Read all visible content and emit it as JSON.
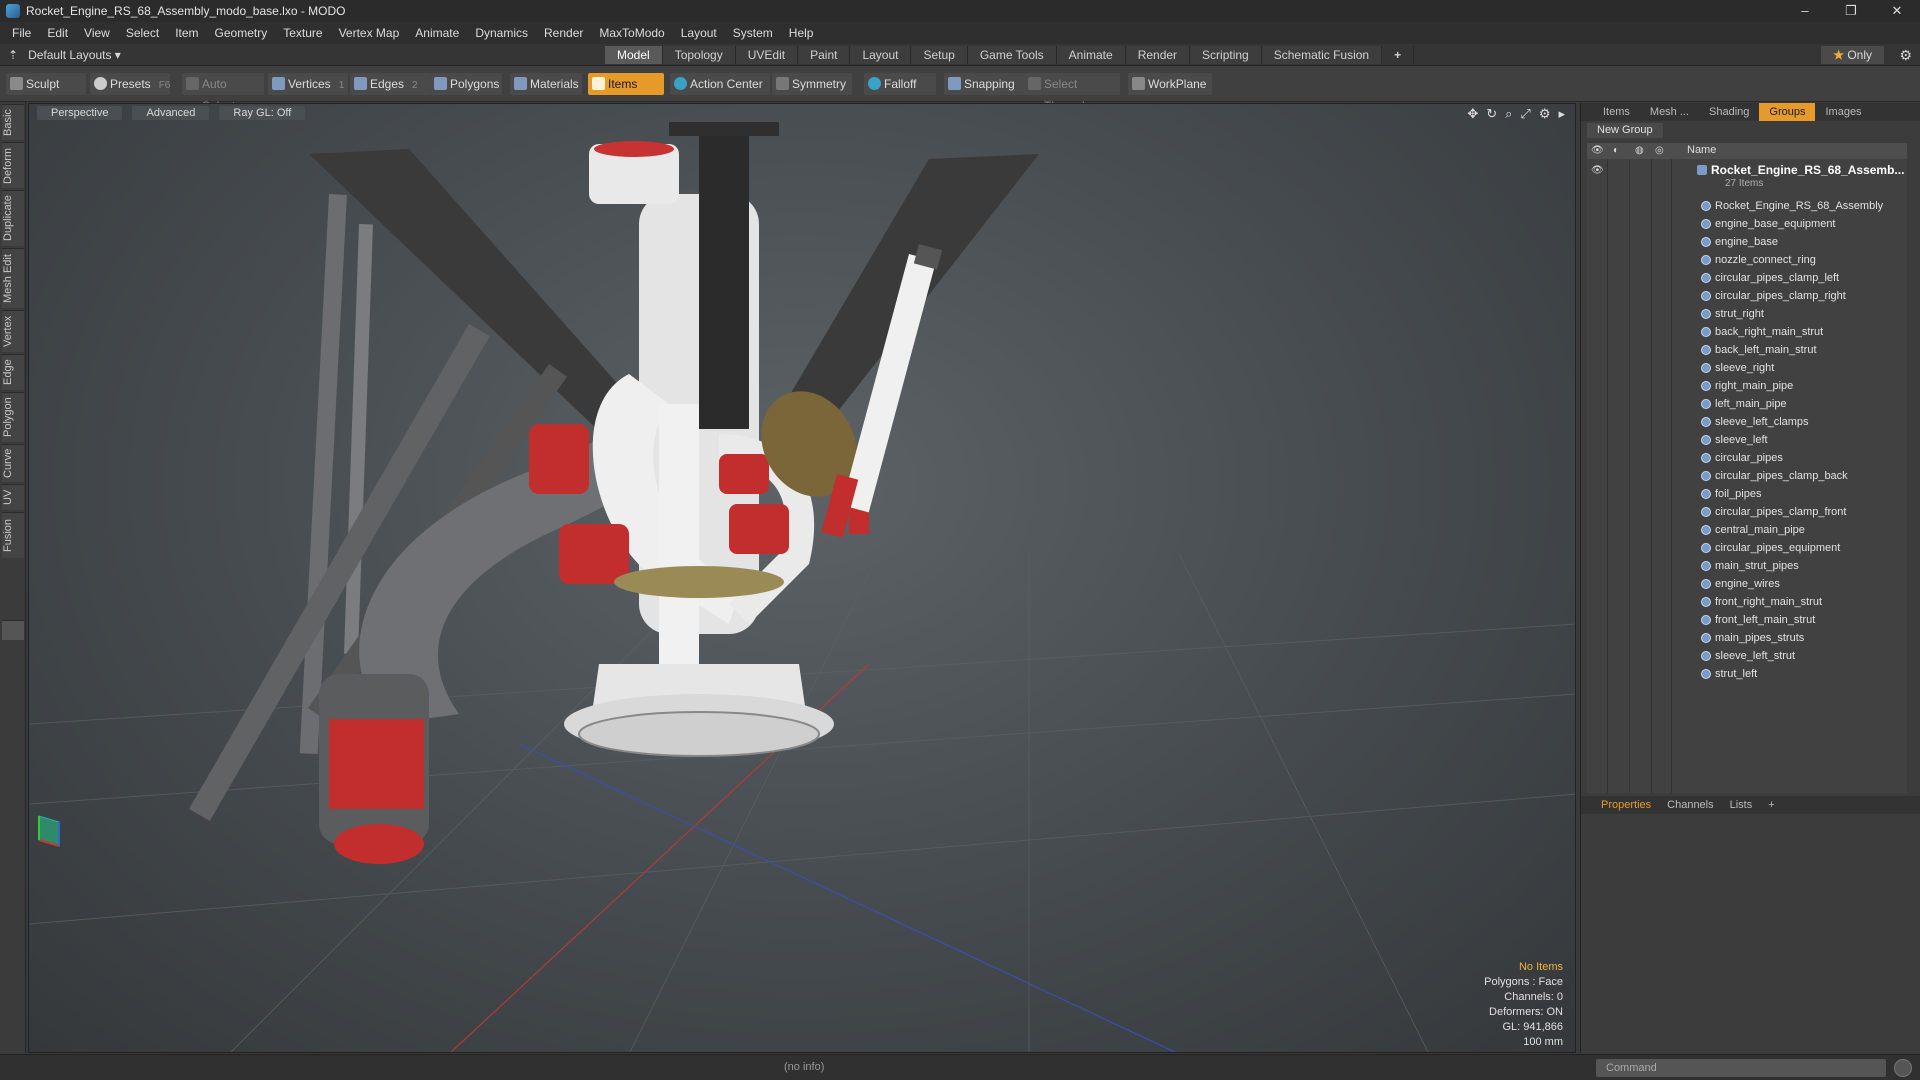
{
  "window": {
    "title": "Rocket_Engine_RS_68_Assembly_modo_base.lxo - MODO",
    "controls": [
      "–",
      "❐",
      "✕"
    ]
  },
  "menu": [
    "File",
    "Edit",
    "View",
    "Select",
    "Item",
    "Geometry",
    "Texture",
    "Vertex Map",
    "Animate",
    "Dynamics",
    "Render",
    "MaxToModo",
    "Layout",
    "System",
    "Help"
  ],
  "layout_bar": {
    "layouts_label": "Default Layouts ▾",
    "tabs": [
      "Model",
      "Topology",
      "UVEdit",
      "Paint",
      "Layout",
      "Setup",
      "Game Tools",
      "Animate",
      "Render",
      "Scripting",
      "Schematic Fusion"
    ],
    "active_tab": "Model",
    "add": "+",
    "only_label": "Only"
  },
  "toolbar": {
    "sculpt": "Sculpt",
    "presets": "Presets",
    "presets_key": "F6",
    "auto_select": "Auto Select",
    "vertices": "Vertices",
    "vertices_count": "1",
    "edges": "Edges",
    "edges_count": "2",
    "polygons": "Polygons",
    "materials": "Materials",
    "items": "Items",
    "action_center": "Action Center",
    "symmetry": "Symmetry",
    "falloff": "Falloff",
    "snapping": "Snapping",
    "select_through": "Select Through",
    "workplane": "WorkPlane"
  },
  "left_tabs": [
    "Basic",
    "Deform",
    "Duplicate",
    "Mesh Edit",
    "Vertex",
    "Edge",
    "Polygon",
    "Curve",
    "UV",
    "Fusion"
  ],
  "viewport": {
    "view": "Perspective",
    "shading": "Advanced",
    "raygl": "Ray GL: Off",
    "info": {
      "items": "No Items",
      "polygons": "Polygons : Face",
      "channels": "Channels: 0",
      "deformers": "Deformers: ON",
      "gl": "GL: 941,866",
      "scale": "100 mm"
    }
  },
  "right_panel": {
    "tabs": [
      "Items",
      "Mesh ...",
      "Shading",
      "Groups",
      "Images"
    ],
    "active_tab": "Groups",
    "new_group": "New Group",
    "column_name": "Name",
    "group": {
      "name": "Rocket_Engine_RS_68_Assemb...",
      "count": "27 Items"
    },
    "items": [
      "Rocket_Engine_RS_68_Assembly",
      "engine_base_equipment",
      "engine_base",
      "nozzle_connect_ring",
      "circular_pipes_clamp_left",
      "circular_pipes_clamp_right",
      "strut_right",
      "back_right_main_strut",
      "back_left_main_strut",
      "sleeve_right",
      "right_main_pipe",
      "left_main_pipe",
      "sleeve_left_clamps",
      "sleeve_left",
      "circular_pipes",
      "circular_pipes_clamp_back",
      "foil_pipes",
      "circular_pipes_clamp_front",
      "central_main_pipe",
      "circular_pipes_equipment",
      "main_strut_pipes",
      "engine_wires",
      "front_right_main_strut",
      "front_left_main_strut",
      "main_pipes_struts",
      "sleeve_left_strut",
      "strut_left"
    ],
    "bottom_tabs": [
      "Properties",
      "Channels",
      "Lists",
      "+"
    ],
    "bottom_active": "Properties"
  },
  "status": {
    "info": "(no info)",
    "command_placeholder": "Command"
  },
  "colors": {
    "accent": "#e69a2a",
    "accent_text": "#f2b03a"
  }
}
